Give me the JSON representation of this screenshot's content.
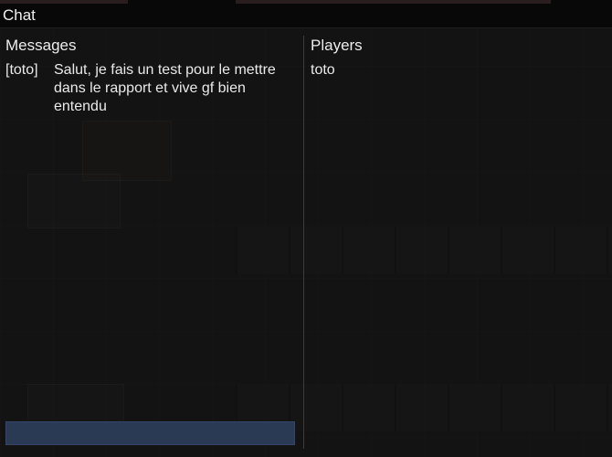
{
  "window": {
    "title": "Chat"
  },
  "messages": {
    "heading": "Messages",
    "items": [
      {
        "author": "[toto]",
        "text": "Salut, je fais un test pour le mettre dans le rapport et vive gf bien entendu"
      }
    ]
  },
  "players": {
    "heading": "Players",
    "items": [
      {
        "name": "toto"
      }
    ]
  },
  "input": {
    "value": "",
    "placeholder": ""
  },
  "colors": {
    "input_background": "#2a3a55",
    "titlebar": "#080808",
    "text": "#eaeaea"
  }
}
